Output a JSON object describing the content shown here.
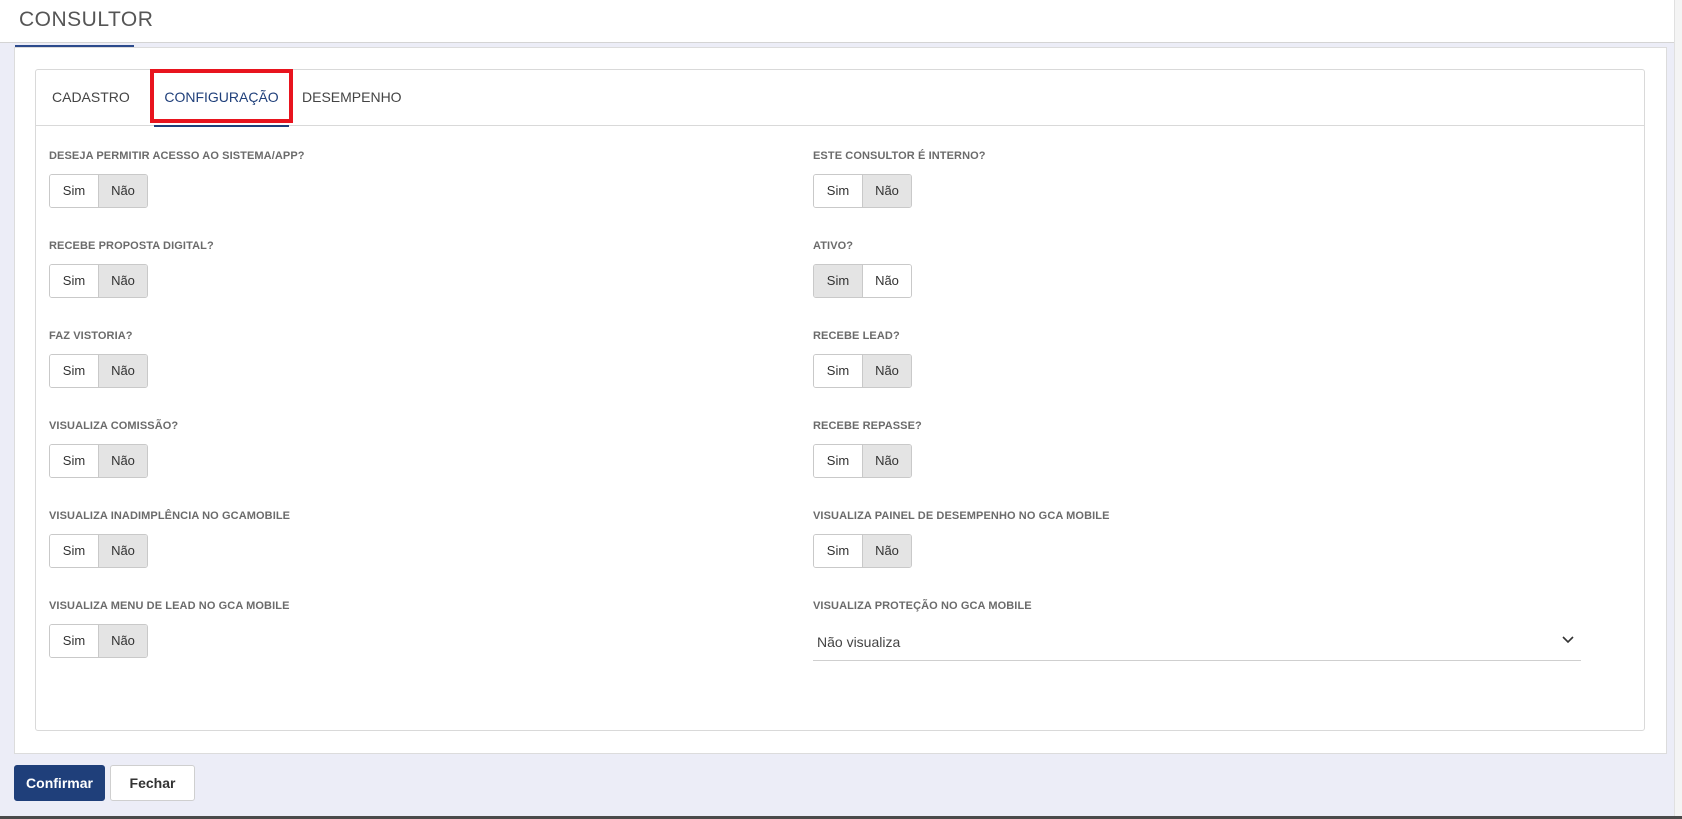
{
  "header": {
    "title": "CONSULTOR"
  },
  "tabs": [
    {
      "label": "CADASTRO",
      "active": false
    },
    {
      "label": "CONFIGURAÇÃO",
      "active": true
    },
    {
      "label": "DESEMPENHO",
      "active": false
    }
  ],
  "toggle_labels": {
    "yes": "Sim",
    "no": "Não"
  },
  "left_fields": [
    {
      "label": "DESEJA PERMITIR ACESSO AO SISTEMA/APP?",
      "selected": "Não"
    },
    {
      "label": "RECEBE PROPOSTA DIGITAL?",
      "selected": "Não"
    },
    {
      "label": "FAZ VISTORIA?",
      "selected": "Não"
    },
    {
      "label": "VISUALIZA COMISSÃO?",
      "selected": "Não"
    },
    {
      "label": "VISUALIZA INADIMPLÊNCIA NO GCAMOBILE",
      "selected": "Não"
    },
    {
      "label": "VISUALIZA MENU DE LEAD NO GCA MOBILE",
      "selected": "Não"
    }
  ],
  "right_fields": [
    {
      "label": "ESTE CONSULTOR É INTERNO?",
      "selected": "Não"
    },
    {
      "label": "ATIVO?",
      "selected": "Sim"
    },
    {
      "label": "RECEBE LEAD?",
      "selected": "Não"
    },
    {
      "label": "RECEBE REPASSE?",
      "selected": "Não"
    },
    {
      "label": "VISUALIZA PAINEL DE DESEMPENHO NO GCA MOBILE",
      "selected": "Não"
    }
  ],
  "select_field": {
    "label": "VISUALIZA PROTEÇÃO NO GCA MOBILE",
    "value": "Não visualiza",
    "icon": "chevron-down-icon"
  },
  "buttons": {
    "confirm": "Confirmar",
    "close": "Fechar"
  },
  "colors": {
    "primary": "#1f3f7a",
    "highlight": "#e8141e",
    "toggle_selected": "#e4e4e4"
  }
}
